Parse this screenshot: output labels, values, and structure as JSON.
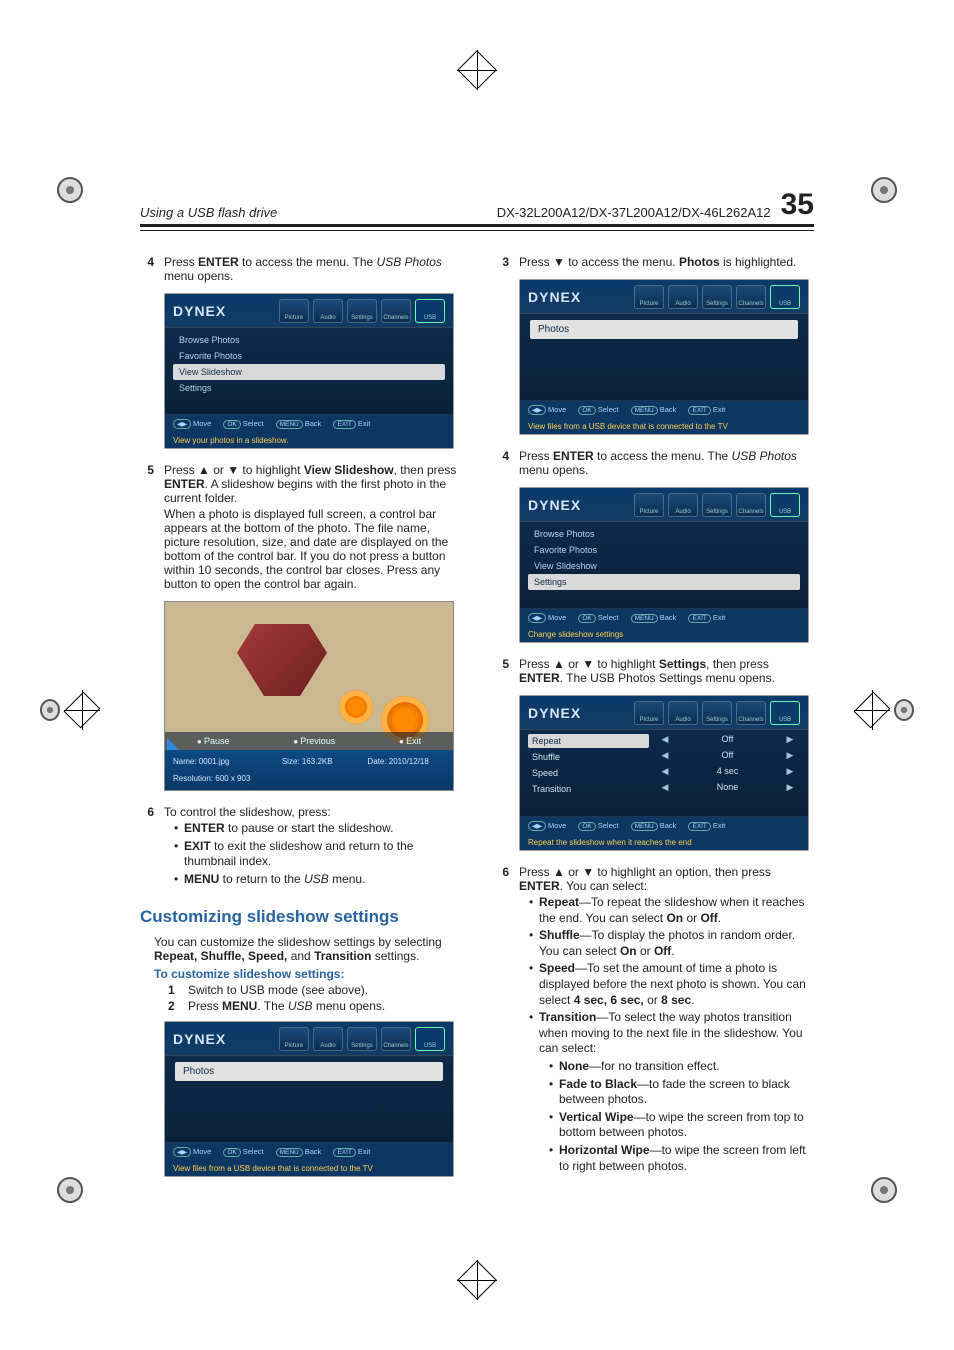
{
  "header": {
    "section": "Using a USB flash drive",
    "models": "DX-32L200A12/DX-37L200A12/DX-46L262A12",
    "page": "35"
  },
  "brand": "DYNEX",
  "osdTabs": [
    "Picture",
    "Audio",
    "Settings",
    "Channels",
    "USB"
  ],
  "col1": {
    "step4": {
      "n": "4",
      "pre": "Press ",
      "b1": "ENTER",
      "mid": " to access the menu. The ",
      "i1": "USB Photos",
      "post": " menu opens."
    },
    "usbMenu": {
      "items": [
        "Browse Photos",
        "Favorite Photos",
        "View Slideshow",
        "Settings"
      ],
      "selectedIndex": 2,
      "footer": {
        "move": "Move",
        "select": "Select",
        "backKey": "MENU",
        "back": "Back",
        "exitKey": "EXIT",
        "exit": "Exit"
      },
      "hint": "View your photos in a slideshow."
    },
    "step5": {
      "n": "5",
      "l1a": "Press ▲ or ▼ to highlight ",
      "l1b": "View Slideshow",
      "l1c": ", then press ",
      "l1d": "ENTER",
      "l1e": ". A slideshow begins with the first photo in the current folder.",
      "l2": "When a photo is displayed full screen, a control bar appears at the bottom of the photo. The file name, picture resolution, size, and date are displayed on the bottom of the control bar. If you do not press a button within 10 seconds, the control bar closes. Press any button to open the control bar again."
    },
    "photoBar": {
      "pause": "Pause",
      "prev": "Previous",
      "exit": "Exit"
    },
    "photoInfo": {
      "nameLabel": "Name:",
      "name": "0001.jpg",
      "resLabel": "Resolution:",
      "res": "600 x 903",
      "sizeLabel": "Size:",
      "size": "163.2KB",
      "dateLabel": "Date:",
      "date": "2010/12/18"
    },
    "step6": {
      "n": "6",
      "lead": "To control the slideshow, press:",
      "items": [
        {
          "b": "ENTER",
          "t": " to pause or start the slideshow."
        },
        {
          "b": "EXIT",
          "t": " to exit the slideshow and return to the thumbnail index."
        },
        {
          "b": "MENU",
          "t": " to return to the ",
          "i": "USB",
          "t2": " menu."
        }
      ]
    },
    "sectTitle": "Customizing slideshow settings",
    "intro1": "You can customize the slideshow settings by selecting ",
    "introB": "Repeat, Shuffle, Speed,",
    "introAnd": " and ",
    "introB2": "Transition",
    "introEnd": " settings.",
    "subhead": "To customize slideshow settings:",
    "n1": {
      "n": "1",
      "t": "Switch to USB mode (see above)."
    },
    "n2": {
      "n": "2",
      "a": "Press ",
      "b": "MENU",
      "c": ". The ",
      "i": "USB",
      "d": " menu opens."
    },
    "photosOnly": {
      "label": "Photos",
      "footer": {
        "move": "Move",
        "select": "Select",
        "backKey": "MENU",
        "back": "Back",
        "exitKey": "EXIT",
        "exit": "Exit"
      },
      "hint": "View files from a USB device that is connected to the TV"
    }
  },
  "col2": {
    "step3": {
      "n": "3",
      "a": "Press ▼ to access the menu. ",
      "b": "Photos",
      "c": " is highlighted."
    },
    "photosOnly": {
      "label": "Photos",
      "footer": {
        "move": "Move",
        "select": "Select",
        "backKey": "MENU",
        "back": "Back",
        "exitKey": "EXIT",
        "exit": "Exit"
      },
      "hint": "View files from a USB device that is connected to the TV"
    },
    "step4": {
      "n": "4",
      "a": "Press ",
      "b": "ENTER",
      "c": " to access the menu. The ",
      "i": "USB Photos",
      "d": " menu opens."
    },
    "usbMenu": {
      "items": [
        "Browse Photos",
        "Favorite Photos",
        "View Slideshow",
        "Settings"
      ],
      "selectedIndex": 3,
      "footer": {
        "move": "Move",
        "select": "Select",
        "backKey": "MENU",
        "back": "Back",
        "exitKey": "EXIT",
        "exit": "Exit"
      },
      "hint": "Change slideshow settings"
    },
    "step5": {
      "n": "5",
      "a": "Press ▲ or ▼ to highlight ",
      "b": "Settings",
      "c": ", then press ",
      "d": "ENTER",
      "e": ". The USB Photos Settings menu opens."
    },
    "settings": {
      "rows": [
        {
          "label": "Repeat",
          "value": "Off",
          "sel": true
        },
        {
          "label": "Shuffle",
          "value": "Off"
        },
        {
          "label": "Speed",
          "value": "4 sec"
        },
        {
          "label": "Transition",
          "value": "None"
        }
      ],
      "footer": {
        "move": "Move",
        "select": "Select",
        "backKey": "MENU",
        "back": "Back",
        "exitKey": "EXIT",
        "exit": "Exit"
      },
      "hint": "Repeat the slideshow when it reaches the end"
    },
    "step6": {
      "n": "6",
      "lead_a": "Press ▲ or ▼ to highlight an option, then press ",
      "lead_b": "ENTER",
      "lead_c": ". You can select:",
      "opts": [
        {
          "b": "Repeat",
          "t": "—To repeat the slideshow when it reaches the end. You can select ",
          "b2": "On",
          "t2": " or ",
          "b3": "Off",
          "t3": "."
        },
        {
          "b": "Shuffle",
          "t": "—To display the photos in random order. You can select ",
          "b2": "On",
          "t2": " or ",
          "b3": "Off",
          "t3": "."
        },
        {
          "b": "Speed",
          "t": "—To set the amount of time a photo is displayed before the next photo is shown. You can select ",
          "b2": "4 sec, 6 sec,",
          "t2": " or ",
          "b3": "8 sec",
          "t3": "."
        },
        {
          "b": "Transition",
          "t": "—To select the way photos transition when moving to the next file in the slideshow. You can select:"
        }
      ],
      "trans": [
        {
          "b": "None",
          "t": "—for no transition effect."
        },
        {
          "b": "Fade to Black",
          "t": "—to fade the screen to black between photos."
        },
        {
          "b": "Vertical Wipe",
          "t": "—to wipe the screen from top to bottom between photos."
        },
        {
          "b": "Horizontal Wipe",
          "t": "—to wipe the screen from left to right between photos."
        }
      ]
    }
  }
}
